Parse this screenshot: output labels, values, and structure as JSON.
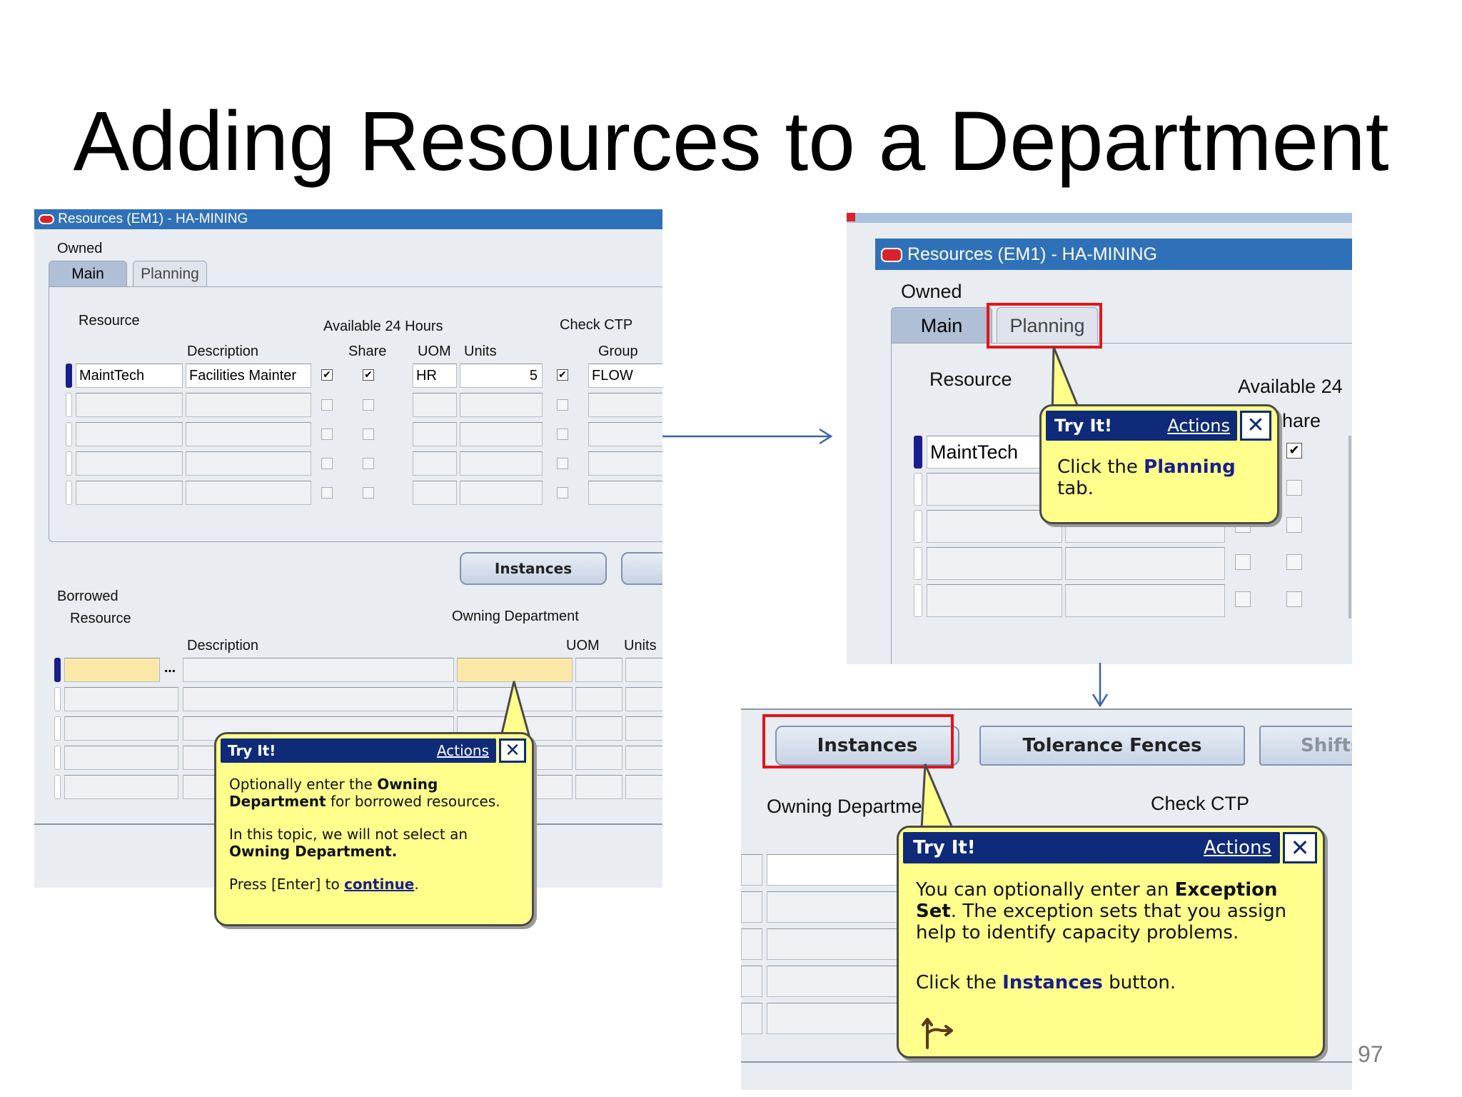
{
  "slide": {
    "title": "Adding Resources to a Department",
    "page_number": "97"
  },
  "colors": {
    "titlebar": "#2f71b8",
    "bubble": "#ffff8c",
    "bubble_header": "#0e2a78",
    "highlight": "#e0161b",
    "input_yellow": "#fbe8a6"
  },
  "left_screen": {
    "window_title": "Resources (EM1) - HA-MINING",
    "section_owned": "Owned",
    "tabs": {
      "main": "Main",
      "planning": "Planning"
    },
    "headers": {
      "resource": "Resource",
      "description": "Description",
      "available_24_hours": "Available 24 Hours",
      "share": "Share",
      "check_ctp": "Check CTP",
      "uom": "UOM",
      "units": "Units",
      "group": "Group"
    },
    "row1": {
      "resource": "MaintTech",
      "description": "Facilities Mainter",
      "uom": "HR",
      "units": "5",
      "group": "FLOW"
    },
    "buttons": {
      "instances": "Instances"
    },
    "borrowed": {
      "section": "Borrowed",
      "resource": "Resource",
      "description": "Description",
      "owning_department": "Owning Department",
      "uom": "UOM",
      "units": "Units"
    },
    "bubble": {
      "title": "Try It!",
      "actions": "Actions",
      "p1_a": "Optionally enter the ",
      "p1_b": "Owning",
      "p1_c": "Department",
      "p1_d": " for borrowed resources.",
      "p2_a": "In this topic, we will not select an",
      "p2_b": "Owning Department.",
      "p3_a": "Press [Enter] to ",
      "p3_link": "continue",
      "p3_end": "."
    }
  },
  "top_right_screen": {
    "window_title": "Resources (EM1) - HA-MINING",
    "section_owned": "Owned",
    "tabs": {
      "main": "Main",
      "planning": "Planning"
    },
    "headers": {
      "resource": "Resource",
      "available_24": "Available 24",
      "share_partial": "hare"
    },
    "row1": {
      "resource": "MaintTech"
    },
    "bubble": {
      "title": "Try It!",
      "actions": "Actions",
      "a": "Click the ",
      "b": "Planning",
      "c": "tab."
    }
  },
  "bottom_right_screen": {
    "buttons": {
      "instances": "Instances",
      "tolerance_fences": "Tolerance Fences",
      "shifts": "Shifts"
    },
    "headers": {
      "owning_department": "Owning Departme",
      "check_ctp": "Check CTP"
    },
    "bubble": {
      "title": "Try It!",
      "actions": "Actions",
      "a": "You can optionally enter an ",
      "b": "Exception",
      "c": "Set",
      "d": ". The exception sets that you assign help to identify capacity problems.",
      "e": "Click the ",
      "f": "Instances",
      "g": " button."
    }
  },
  "icons": [
    "oracle-logo-icon",
    "close-icon",
    "ellipsis-icon",
    "checkbox-icon",
    "next-step-icon",
    "arrow-right-icon",
    "arrow-down-icon"
  ]
}
